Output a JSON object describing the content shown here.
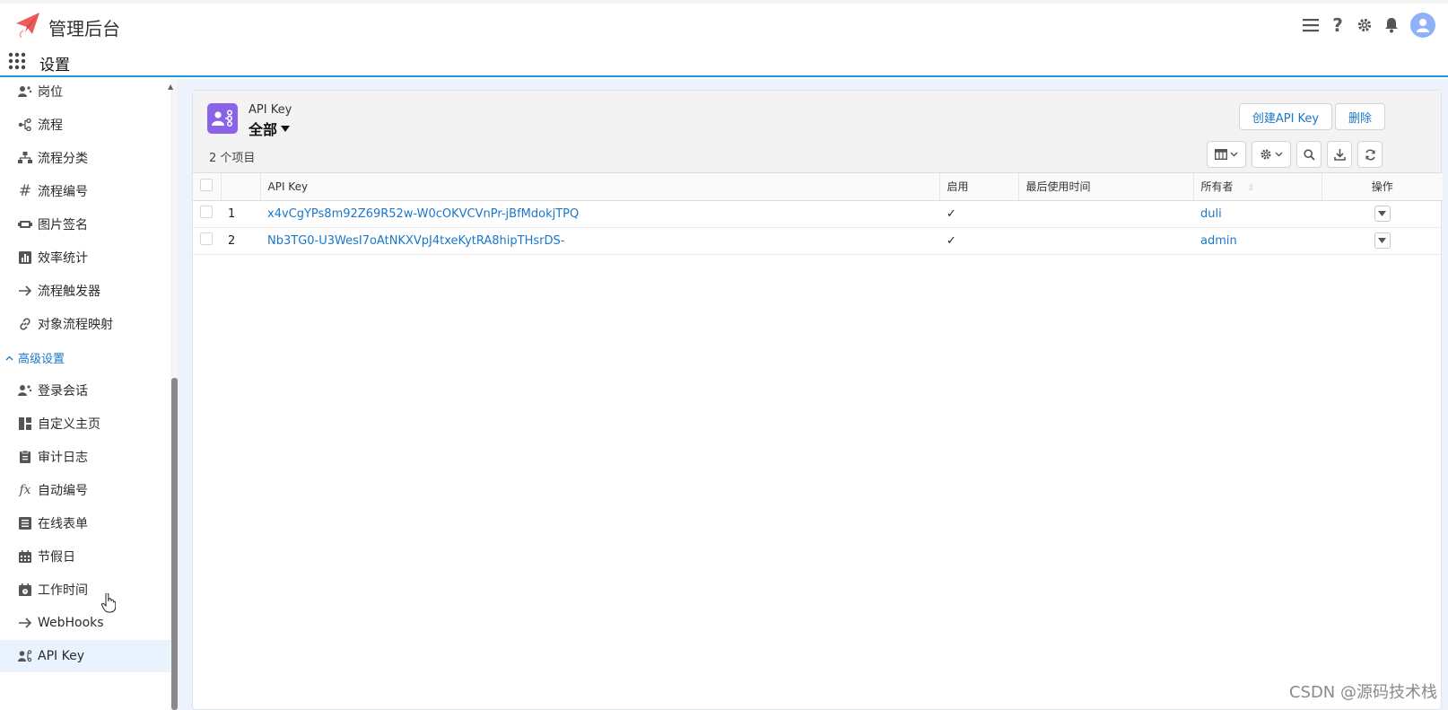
{
  "header": {
    "app_title": "管理后台",
    "icons": [
      "menu-icon",
      "help-icon",
      "gear-icon",
      "bell-icon",
      "user-avatar-icon"
    ]
  },
  "subheader": {
    "title": "设置"
  },
  "sidebar": {
    "items_top": [
      {
        "label": "岗位",
        "icon": "users-icon"
      },
      {
        "label": "流程",
        "icon": "flow-icon"
      },
      {
        "label": "流程分类",
        "icon": "hierarchy-icon"
      },
      {
        "label": "流程编号",
        "icon": "hash-icon"
      },
      {
        "label": "图片签名",
        "icon": "signature-icon"
      },
      {
        "label": "效率统计",
        "icon": "bar-chart-icon"
      },
      {
        "label": "流程触发器",
        "icon": "arrow-right-icon"
      },
      {
        "label": "对象流程映射",
        "icon": "link-icon"
      }
    ],
    "section": {
      "label": "高级设置",
      "icon": "chevron-up-icon"
    },
    "items_bottom": [
      {
        "label": "登录会话",
        "icon": "users-icon"
      },
      {
        "label": "自定义主页",
        "icon": "layout-icon"
      },
      {
        "label": "审计日志",
        "icon": "clipboard-icon"
      },
      {
        "label": "自动编号",
        "icon": "fx-icon"
      },
      {
        "label": "在线表单",
        "icon": "form-icon"
      },
      {
        "label": "节假日",
        "icon": "calendar-icon"
      },
      {
        "label": "工作时间",
        "icon": "calendar-clock-icon"
      },
      {
        "label": "WebHooks",
        "icon": "arrow-right-icon"
      },
      {
        "label": "API Key",
        "icon": "api-key-icon",
        "active": true
      }
    ]
  },
  "main": {
    "object_label": "API Key",
    "view_label": "全部",
    "item_count": "2 个项目",
    "buttons": {
      "create": "创建API Key",
      "delete": "删除"
    },
    "table": {
      "columns": [
        "",
        "",
        "API Key",
        "启用",
        "最后使用时间",
        "所有者",
        "操作"
      ],
      "rows": [
        {
          "num": "1",
          "key": "x4vCgYPs8m92Z69R52w-W0cOKVCVnPr-jBfMdokjTPQ",
          "enabled": "✓",
          "last_used": "",
          "owner": "duli"
        },
        {
          "num": "2",
          "key": "Nb3TG0-U3WesI7oAtNKXVpJ4txeKytRA8hipTHsrDS-",
          "enabled": "✓",
          "last_used": "",
          "owner": "admin"
        }
      ]
    }
  },
  "watermark": "CSDN @源码技术栈",
  "colors": {
    "accent": "#1b77c9",
    "brand_bar": "#1b96d6",
    "object_icon_bg": "#8a63e8",
    "active_bg": "#e9f3fd"
  }
}
